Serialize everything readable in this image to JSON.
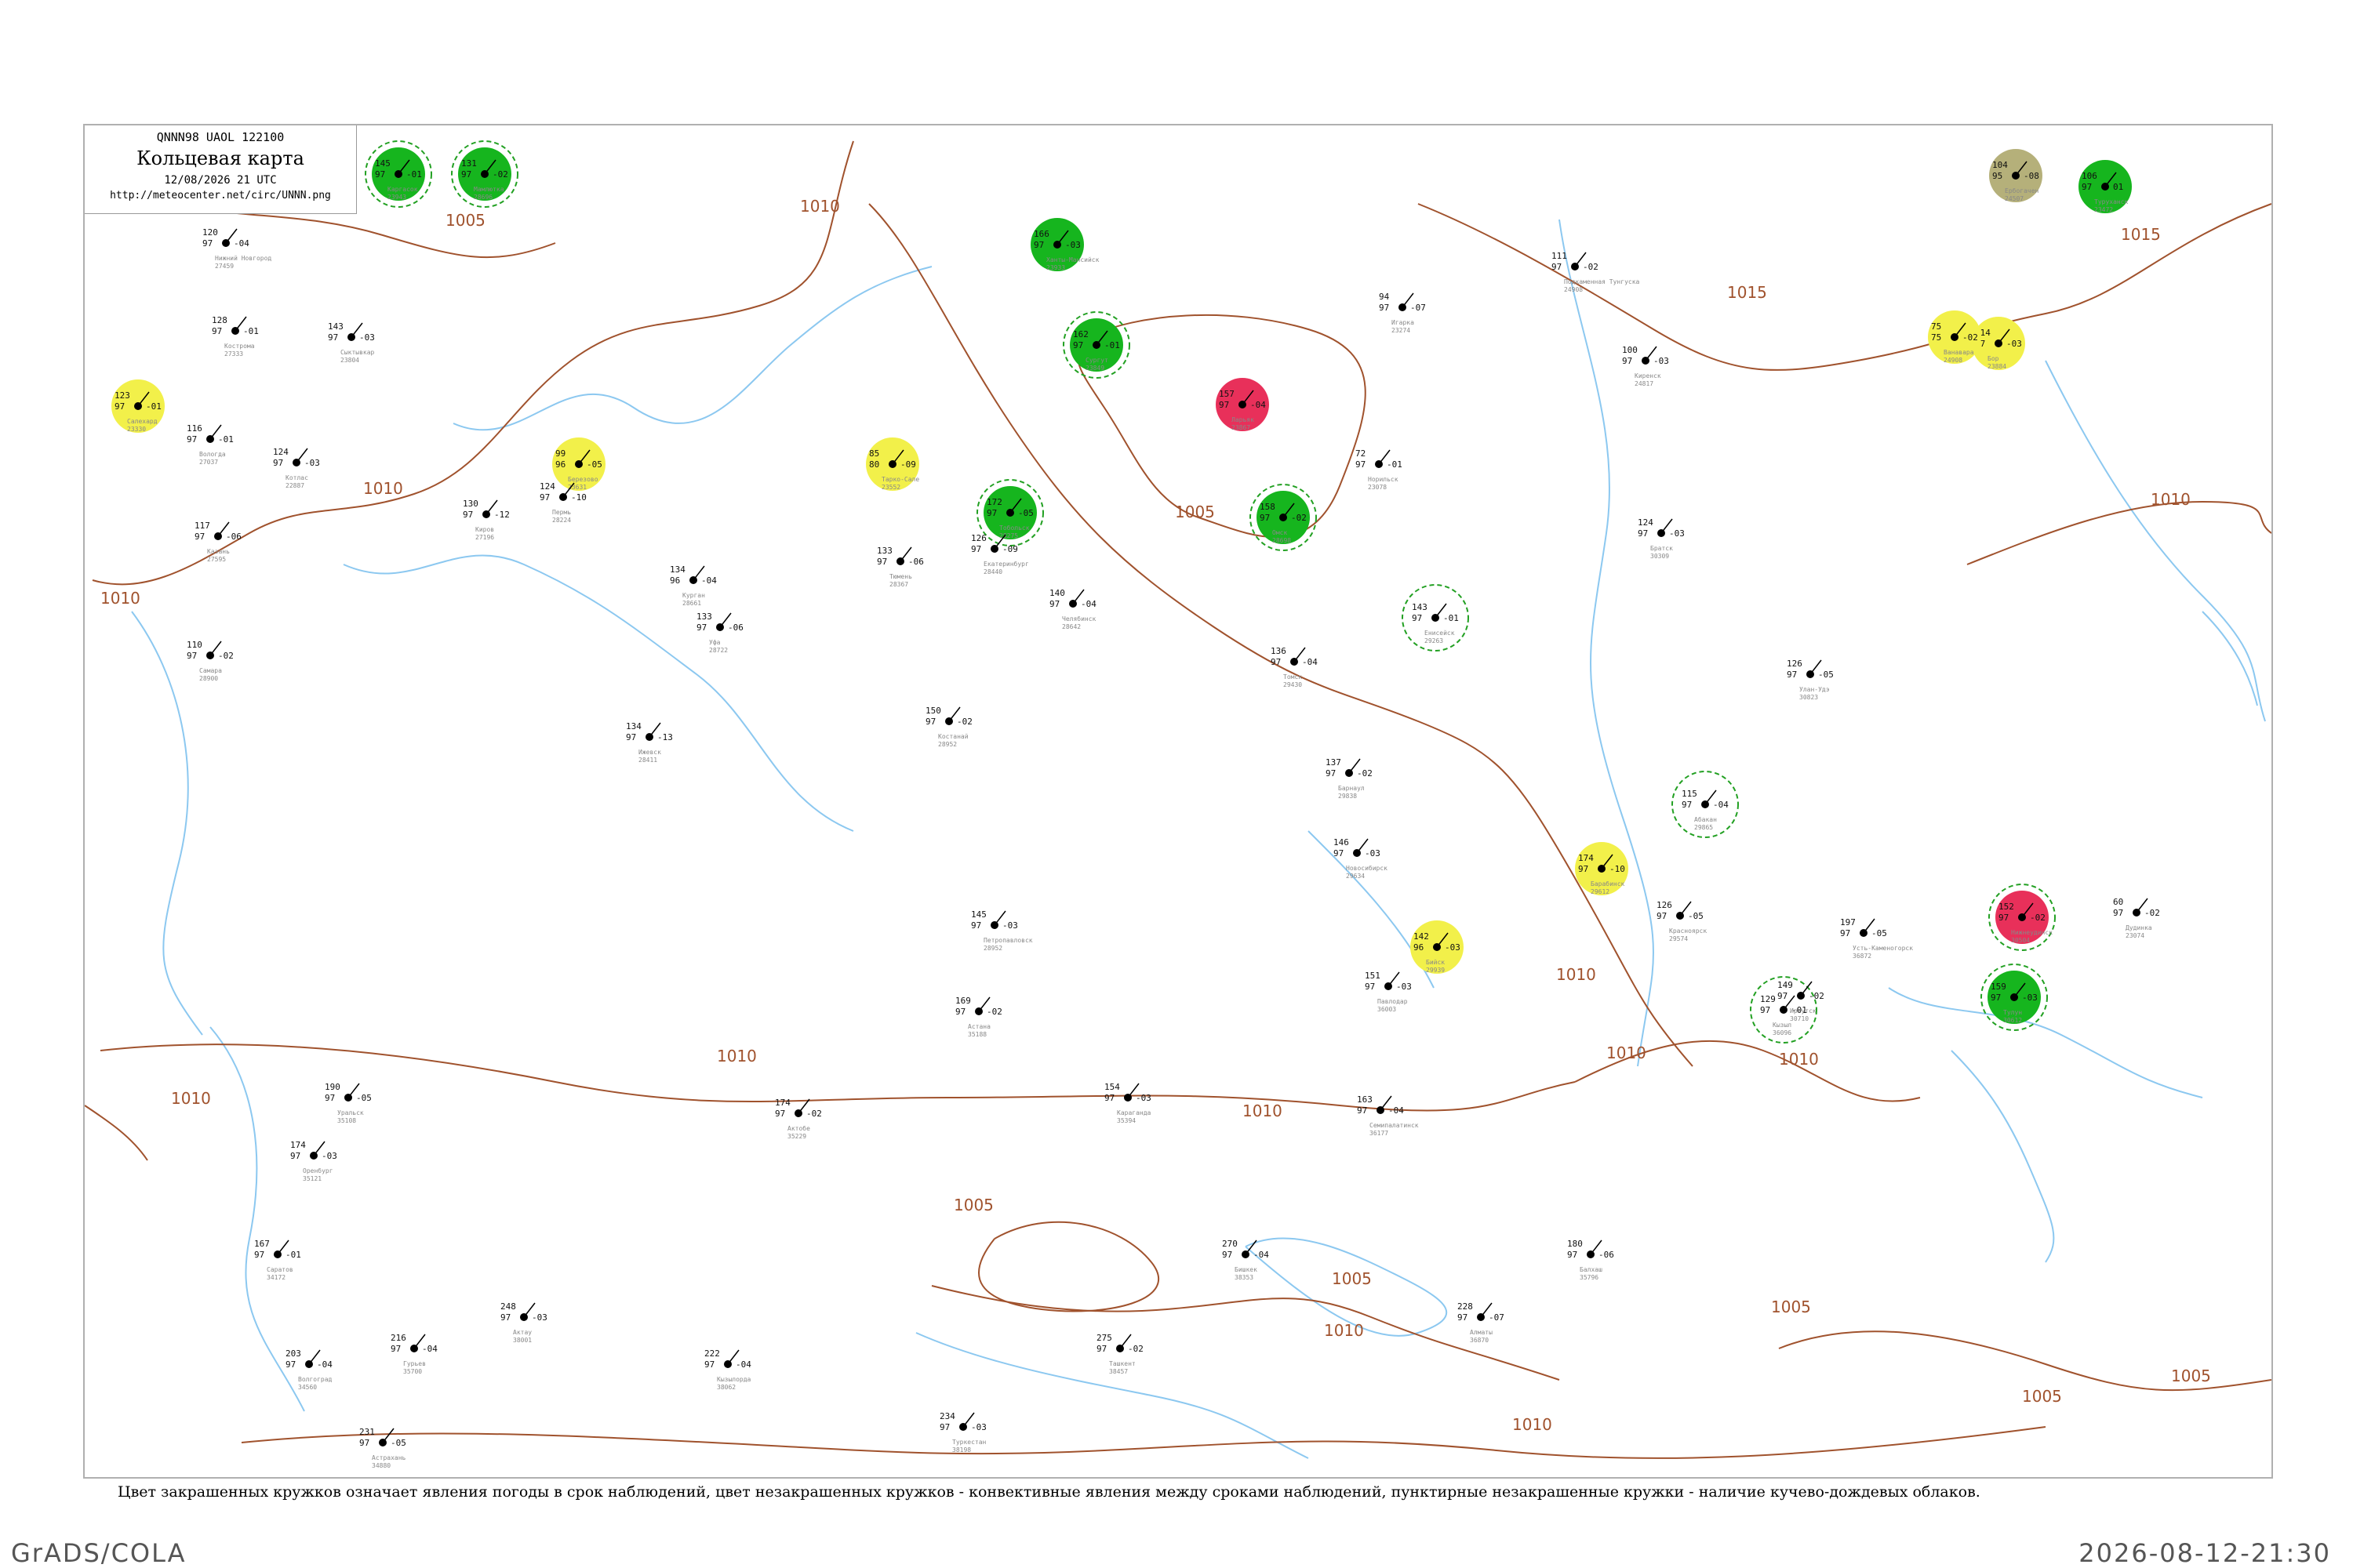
{
  "header": {
    "code_line": "QNNN98  UAOL  122100",
    "title": "Кольцевая карта",
    "datetime": "12/08/2026 21 UTC",
    "url": "http://meteocenter.net/circ/UNNN.png"
  },
  "legend_note": "Цвет закрашенных кружков означает явления погоды в срок наблюдений, цвет незакрашенных кружков - конвективные явления между сроками наблюдений, пунктирные незакрашенные кружки - наличие кучево-дождевых облаков.",
  "footer": {
    "left": "GrADS/COLA",
    "right": "2026-08-12-21:30"
  },
  "colors": {
    "isobar": "#a0522d",
    "river": "#8cc8f0",
    "rain_fill": "#16b51e",
    "thunder_fill": "#e8305a",
    "haze_fill": "#f2f04a",
    "fog_fill": "#b5b07a",
    "cb_ring": "#22a022"
  },
  "isobar_labels": [
    "1005",
    "1010",
    "1010",
    "1010",
    "1015",
    "1015",
    "1010",
    "1010",
    "1005",
    "1010",
    "1010",
    "1010",
    "1010",
    "1005",
    "1005",
    "1010",
    "1010",
    "1005",
    "1005",
    "1005",
    "1010"
  ],
  "stations": [
    {
      "name": "Каргасок",
      "id": "23943",
      "t": "145",
      "d": "97",
      "p": "-01",
      "wx": "rain",
      "cb": true
    },
    {
      "name": "Мамлютка",
      "id": "28696",
      "t": "131",
      "d": "97",
      "p": "-02",
      "wx": "rain",
      "cb": true
    },
    {
      "name": "Сургут",
      "id": "23849",
      "t": "162",
      "d": "97",
      "p": "-01",
      "wx": "rain",
      "cb": true
    },
    {
      "name": "Ханты-Мансийск",
      "id": "23933",
      "t": "166",
      "d": "97",
      "p": "-03",
      "wx": "rain",
      "cb": false
    },
    {
      "name": "Ларьяк",
      "id": "23867",
      "t": "157",
      "d": "97",
      "p": "-04",
      "wx": "thunder",
      "cb": false
    },
    {
      "name": "Тобольск",
      "id": "28275",
      "t": "172",
      "d": "97",
      "p": "-05",
      "wx": "rain",
      "cb": true
    },
    {
      "name": "Омск",
      "id": "28698",
      "t": "158",
      "d": "97",
      "p": "-02",
      "wx": "rain",
      "cb": true
    },
    {
      "name": "Туруханск",
      "id": "23472",
      "t": "106",
      "d": "97",
      "p": "01",
      "wx": "rain",
      "cb": false
    },
    {
      "name": "Бор",
      "id": "23884",
      "t": "114",
      "d": "97",
      "p": "-03",
      "wx": "haze",
      "cb": false
    },
    {
      "name": "Ербогачен",
      "id": "24507",
      "t": "104",
      "d": "95",
      "p": "-08",
      "wx": "fog",
      "cb": false
    },
    {
      "name": "Нижнеудинск",
      "id": "30504",
      "t": "152",
      "d": "97",
      "p": "-02",
      "wx": "thunder",
      "cb": true
    },
    {
      "name": "Тулун",
      "id": "30612",
      "t": "159",
      "d": "97",
      "p": "-03",
      "wx": "rain",
      "cb": true
    },
    {
      "name": "Барабинск",
      "id": "29612",
      "t": "174",
      "d": "97",
      "p": "-10",
      "wx": "haze",
      "cb": false
    },
    {
      "name": "Бийск",
      "id": "29939",
      "t": "142",
      "d": "96",
      "p": "-03",
      "wx": "haze",
      "cb": false
    },
    {
      "name": "Ванавара",
      "id": "24908",
      "t": "75",
      "d": "75",
      "p": "-02",
      "wx": "haze",
      "cb": false
    },
    {
      "name": "Салехард",
      "id": "23330",
      "t": "123",
      "d": "97",
      "p": "-01",
      "wx": "haze",
      "cb": false
    },
    {
      "name": "Березово",
      "id": "23631",
      "t": "99",
      "d": "96",
      "p": "-05",
      "wx": "haze",
      "cb": false
    },
    {
      "name": "Тарко-Сале",
      "id": "23552",
      "t": "85",
      "d": "80",
      "p": "-09",
      "wx": "haze",
      "cb": false
    },
    {
      "name": "Кызыл",
      "id": "36096",
      "t": "129",
      "d": "97",
      "p": "-01",
      "wx": "none",
      "cb": true
    },
    {
      "name": "Абакан",
      "id": "29865",
      "t": "115",
      "d": "97",
      "p": "-04",
      "wx": "none",
      "cb": true
    },
    {
      "name": "Красноярск",
      "id": "29574",
      "t": "126",
      "d": "97",
      "p": "-05",
      "wx": "none",
      "cb": false
    },
    {
      "name": "Енисейск",
      "id": "29263",
      "t": "143",
      "d": "97",
      "p": "-01",
      "wx": "none",
      "cb": true
    },
    {
      "name": "Новосибирск",
      "id": "29634",
      "t": "146",
      "d": "97",
      "p": "-03",
      "wx": "none",
      "cb": false
    },
    {
      "name": "Томск",
      "id": "29430",
      "t": "136",
      "d": "97",
      "p": "-04",
      "wx": "none",
      "cb": false
    },
    {
      "name": "Барнаул",
      "id": "29838",
      "t": "137",
      "d": "97",
      "p": "-02",
      "wx": "none",
      "cb": false
    },
    {
      "name": "Павлодар",
      "id": "36003",
      "t": "151",
      "d": "97",
      "p": "-03",
      "wx": "none",
      "cb": false
    },
    {
      "name": "Семипалатинск",
      "id": "36177",
      "t": "163",
      "d": "97",
      "p": "-04",
      "wx": "none",
      "cb": false
    },
    {
      "name": "Курган",
      "id": "28661",
      "t": "134",
      "d": "96",
      "p": "-04",
      "wx": "none",
      "cb": false
    },
    {
      "name": "Екатеринбург",
      "id": "28440",
      "t": "126",
      "d": "97",
      "p": "-09",
      "wx": "none",
      "cb": false
    },
    {
      "name": "Тюмень",
      "id": "28367",
      "t": "133",
      "d": "97",
      "p": "-06",
      "wx": "none",
      "cb": false
    },
    {
      "name": "Челябинск",
      "id": "28642",
      "t": "140",
      "d": "97",
      "p": "-04",
      "wx": "none",
      "cb": false
    },
    {
      "name": "Костанай",
      "id": "28952",
      "t": "150",
      "d": "97",
      "p": "-02",
      "wx": "none",
      "cb": false
    },
    {
      "name": "Петропавловск",
      "id": "28952",
      "t": "145",
      "d": "97",
      "p": "-03",
      "wx": "none",
      "cb": false
    },
    {
      "name": "Астана",
      "id": "35188",
      "t": "169",
      "d": "97",
      "p": "-02",
      "wx": "none",
      "cb": false
    },
    {
      "name": "Караганда",
      "id": "35394",
      "t": "154",
      "d": "97",
      "p": "-03",
      "wx": "none",
      "cb": false
    },
    {
      "name": "Актобе",
      "id": "35229",
      "t": "174",
      "d": "97",
      "p": "-02",
      "wx": "none",
      "cb": false
    },
    {
      "name": "Уральск",
      "id": "35108",
      "t": "190",
      "d": "97",
      "p": "-05",
      "wx": "none",
      "cb": false
    },
    {
      "name": "Оренбург",
      "id": "35121",
      "t": "174",
      "d": "97",
      "p": "-03",
      "wx": "none",
      "cb": false
    },
    {
      "name": "Пермь",
      "id": "28224",
      "t": "124",
      "d": "97",
      "p": "-10",
      "wx": "none",
      "cb": false
    },
    {
      "name": "Уфа",
      "id": "28722",
      "t": "133",
      "d": "97",
      "p": "-06",
      "wx": "none",
      "cb": false
    },
    {
      "name": "Ижевск",
      "id": "28411",
      "t": "134",
      "d": "97",
      "p": "-13",
      "wx": "none",
      "cb": false
    },
    {
      "name": "Киров",
      "id": "27196",
      "t": "130",
      "d": "97",
      "p": "-12",
      "wx": "none",
      "cb": false
    },
    {
      "name": "Сыктывкар",
      "id": "23804",
      "t": "143",
      "d": "97",
      "p": "-03",
      "wx": "none",
      "cb": false
    },
    {
      "name": "Котлас",
      "id": "22887",
      "t": "124",
      "d": "97",
      "p": "-03",
      "wx": "none",
      "cb": false
    },
    {
      "name": "Вологда",
      "id": "27037",
      "t": "116",
      "d": "97",
      "p": "-01",
      "wx": "none",
      "cb": false
    },
    {
      "name": "Кострома",
      "id": "27333",
      "t": "128",
      "d": "97",
      "p": "-01",
      "wx": "none",
      "cb": false
    },
    {
      "name": "Нижний Новгород",
      "id": "27459",
      "t": "120",
      "d": "97",
      "p": "-04",
      "wx": "none",
      "cb": false
    },
    {
      "name": "Казань",
      "id": "27595",
      "t": "117",
      "d": "97",
      "p": "-06",
      "wx": "none",
      "cb": false
    },
    {
      "name": "Самара",
      "id": "28900",
      "t": "110",
      "d": "97",
      "p": "-02",
      "wx": "none",
      "cb": false
    },
    {
      "name": "Саратов",
      "id": "34172",
      "t": "167",
      "d": "97",
      "p": "-01",
      "wx": "none",
      "cb": false
    },
    {
      "name": "Волгоград",
      "id": "34560",
      "t": "203",
      "d": "97",
      "p": "-04",
      "wx": "none",
      "cb": false
    },
    {
      "name": "Астрахань",
      "id": "34880",
      "t": "231",
      "d": "97",
      "p": "-05",
      "wx": "none",
      "cb": false
    },
    {
      "name": "Гурьев",
      "id": "35700",
      "t": "216",
      "d": "97",
      "p": "-04",
      "wx": "none",
      "cb": false
    },
    {
      "name": "Актау",
      "id": "38001",
      "t": "248",
      "d": "97",
      "p": "-03",
      "wx": "none",
      "cb": false
    },
    {
      "name": "Кызылорда",
      "id": "38062",
      "t": "222",
      "d": "97",
      "p": "-04",
      "wx": "none",
      "cb": false
    },
    {
      "name": "Туркестан",
      "id": "38198",
      "t": "234",
      "d": "97",
      "p": "-03",
      "wx": "none",
      "cb": false
    },
    {
      "name": "Ташкент",
      "id": "38457",
      "t": "275",
      "d": "97",
      "p": "-02",
      "wx": "none",
      "cb": false
    },
    {
      "name": "Бишкек",
      "id": "38353",
      "t": "270",
      "d": "97",
      "p": "-04",
      "wx": "none",
      "cb": false
    },
    {
      "name": "Алматы",
      "id": "36870",
      "t": "228",
      "d": "97",
      "p": "-07",
      "wx": "none",
      "cb": false
    },
    {
      "name": "Балхаш",
      "id": "35796",
      "t": "180",
      "d": "97",
      "p": "-06",
      "wx": "none",
      "cb": false
    },
    {
      "name": "Усть-Каменогорск",
      "id": "36872",
      "t": "197",
      "d": "97",
      "p": "-05",
      "wx": "none",
      "cb": false
    },
    {
      "name": "Иркутск",
      "id": "30710",
      "t": "149",
      "d": "97",
      "p": "-02",
      "wx": "none",
      "cb": false
    },
    {
      "name": "Улан-Удэ",
      "id": "30823",
      "t": "126",
      "d": "97",
      "p": "-05",
      "wx": "none",
      "cb": false
    },
    {
      "name": "Братск",
      "id": "30309",
      "t": "124",
      "d": "97",
      "p": "-03",
      "wx": "none",
      "cb": false
    },
    {
      "name": "Киренск",
      "id": "24817",
      "t": "100",
      "d": "97",
      "p": "-03",
      "wx": "none",
      "cb": false
    },
    {
      "name": "Подкаменная Тунгуска",
      "id": "24908",
      "t": "111",
      "d": "97",
      "p": "-02",
      "wx": "none",
      "cb": false
    },
    {
      "name": "Игарка",
      "id": "23274",
      "t": "94",
      "d": "97",
      "p": "-07",
      "wx": "none",
      "cb": false
    },
    {
      "name": "Норильск",
      "id": "23078",
      "t": "72",
      "d": "97",
      "p": "-01",
      "wx": "none",
      "cb": false
    },
    {
      "name": "Дудинка",
      "id": "23074",
      "t": "60",
      "d": "97",
      "p": "-02",
      "wx": "none",
      "cb": false
    }
  ]
}
